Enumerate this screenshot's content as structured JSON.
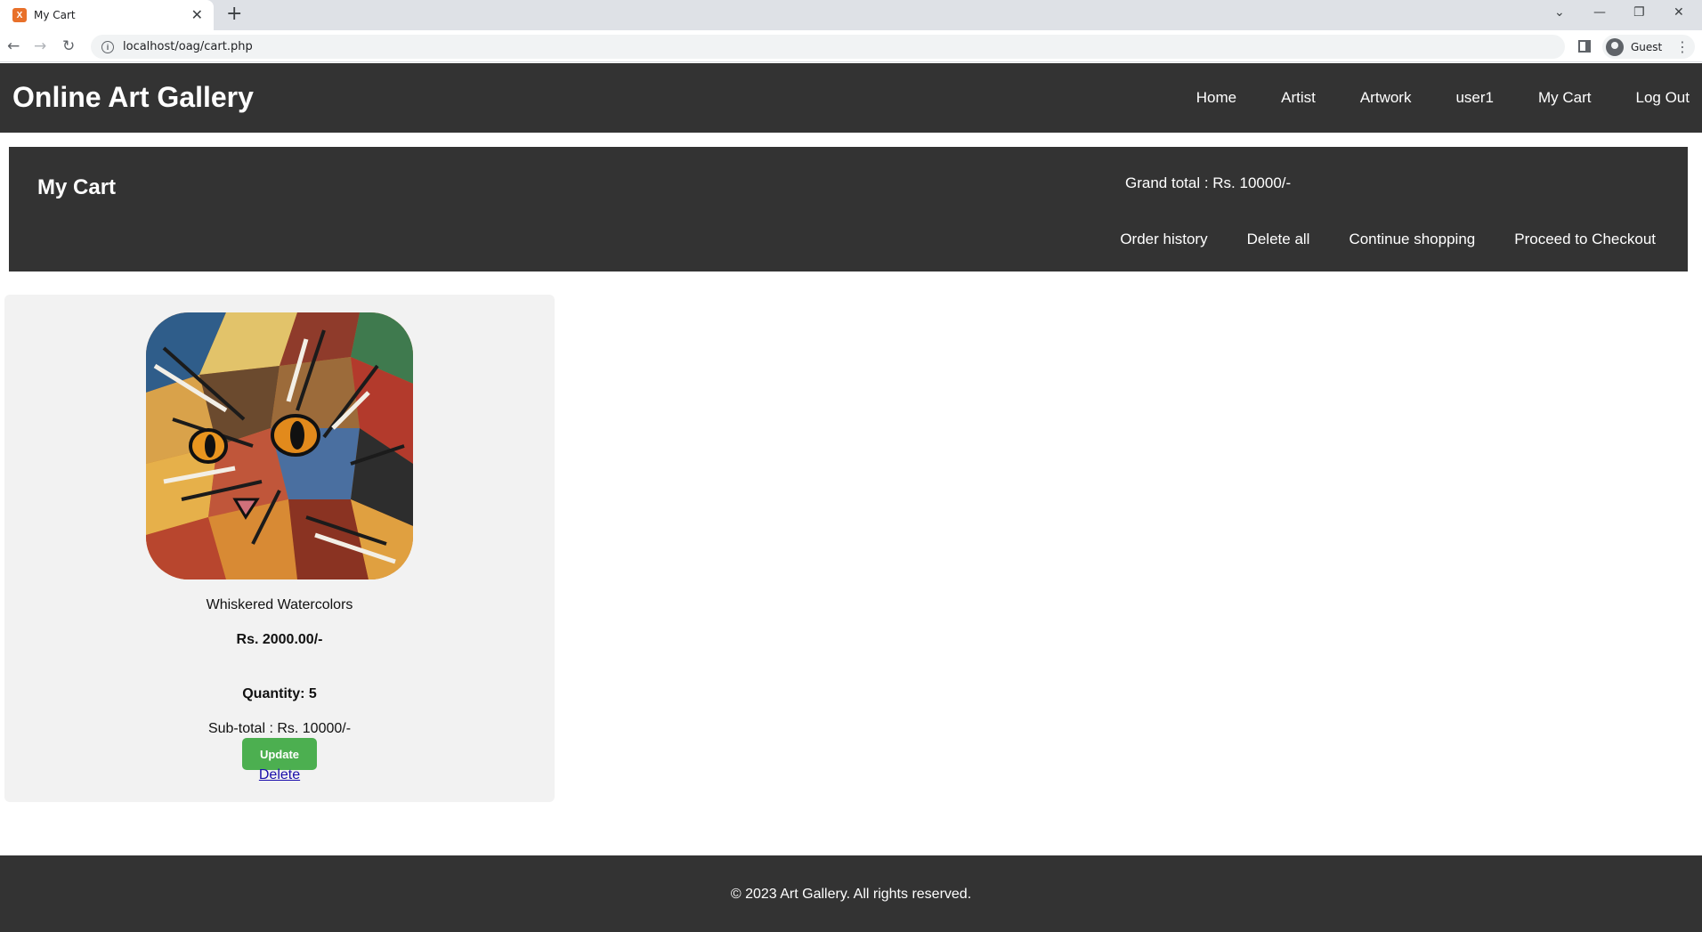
{
  "browser": {
    "tab_title": "My Cart",
    "url": "localhost/oag/cart.php",
    "profile_name": "Guest",
    "favicon_label": "X"
  },
  "site": {
    "title": "Online Art Gallery",
    "nav": [
      "Home",
      "Artist",
      "Artwork",
      "user1",
      "My Cart",
      "Log Out"
    ]
  },
  "cart": {
    "title": "My Cart",
    "grand_total": "Grand total : Rs. 10000/-",
    "actions": [
      "Order history",
      "Delete all",
      "Continue shopping",
      "Proceed to Checkout"
    ]
  },
  "items": [
    {
      "name": "Whiskered Watercolors",
      "price": "Rs. 2000.00/-",
      "quantity": "Quantity: 5",
      "subtotal": "Sub-total : Rs. 10000/-",
      "update_label": "Update",
      "delete_label": "Delete"
    }
  ],
  "footer": {
    "text": "© 2023 Art Gallery. All rights reserved."
  },
  "colors": {
    "header_bg": "#333333",
    "update_button": "#4caf50",
    "card_bg": "#f2f2f2"
  }
}
